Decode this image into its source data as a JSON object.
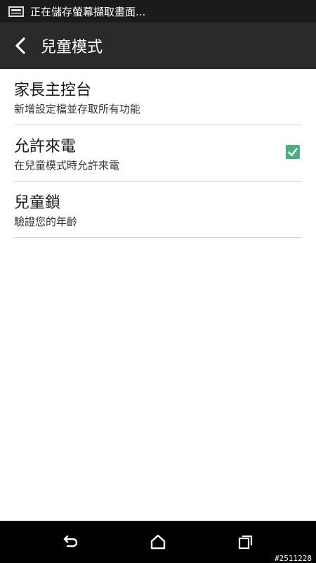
{
  "status_bar": {
    "icon": "screenshot-icon",
    "notification_text": "正在儲存螢幕擷取畫面..."
  },
  "app_bar": {
    "back_icon": "chevron-left-icon",
    "title": "兒童模式"
  },
  "settings": [
    {
      "title": "家長主控台",
      "subtitle": "新增設定檔並存取所有功能",
      "has_checkbox": false
    },
    {
      "title": "允許來電",
      "subtitle": "在兒童模式時允許來電",
      "has_checkbox": true,
      "checked": true
    },
    {
      "title": "兒童鎖",
      "subtitle": "驗證您的年齡",
      "has_checkbox": false
    }
  ],
  "nav_bar": {
    "back_icon": "back-arrow-icon",
    "home_icon": "home-icon",
    "recent_icon": "recent-apps-icon",
    "watermark": "#2511228"
  },
  "colors": {
    "status_bar_bg": "#1b1b1b",
    "app_bar_bg": "#2a2a2a",
    "checkbox_green": "#4caf7d",
    "divider": "#d4d4d4"
  }
}
